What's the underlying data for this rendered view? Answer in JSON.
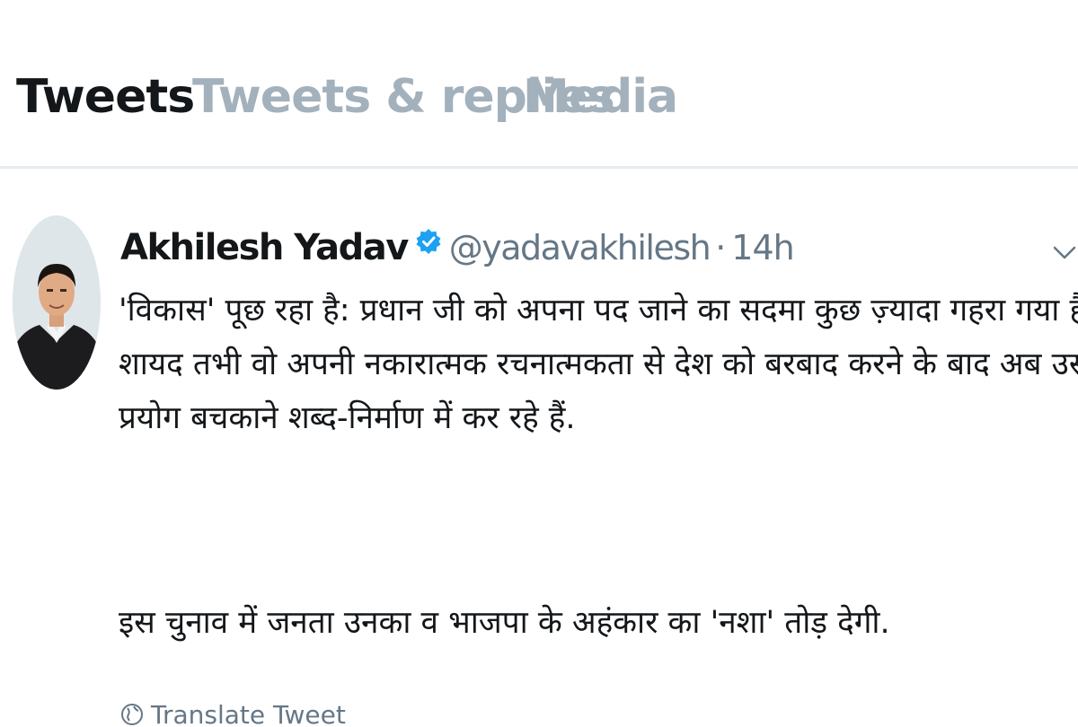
{
  "tabs": [
    {
      "label": "Tweets"
    },
    {
      "label": "Tweets & replies"
    },
    {
      "label": "Media"
    }
  ],
  "tweet": {
    "display_name": "Akhilesh Yadav",
    "handle": "@yadavakhilesh",
    "separator": "·",
    "time": "14h",
    "lines": [
      "'विकास' पूछ रहा है:  प्रधान जी को अपना पद जाने का सदमा कुछ ज़्यादा गहरा गया है क्या?",
      "शायद तभी वो अपनी नकारात्मक रचनात्मकता से देश को बरबाद करने के बाद अब उसका",
      "प्रयोग बचकाने शब्द-निर्माण में कर रहे हैं."
    ],
    "paragraph2": "इस चुनाव में जनता उनका व भाजपा के अहंकार का 'नशा' तोड़ देगी.",
    "translate_label": "Translate Tweet"
  },
  "icons": {
    "verified": "verified-badge-icon",
    "caret": "chevron-down-icon",
    "translate": "globe-icon"
  },
  "colors": {
    "text_primary": "#14171a",
    "text_secondary": "#657786",
    "tab_inactive": "#a3b1bc",
    "verified_blue": "#1da1f2",
    "divider": "#e6ecf0"
  }
}
